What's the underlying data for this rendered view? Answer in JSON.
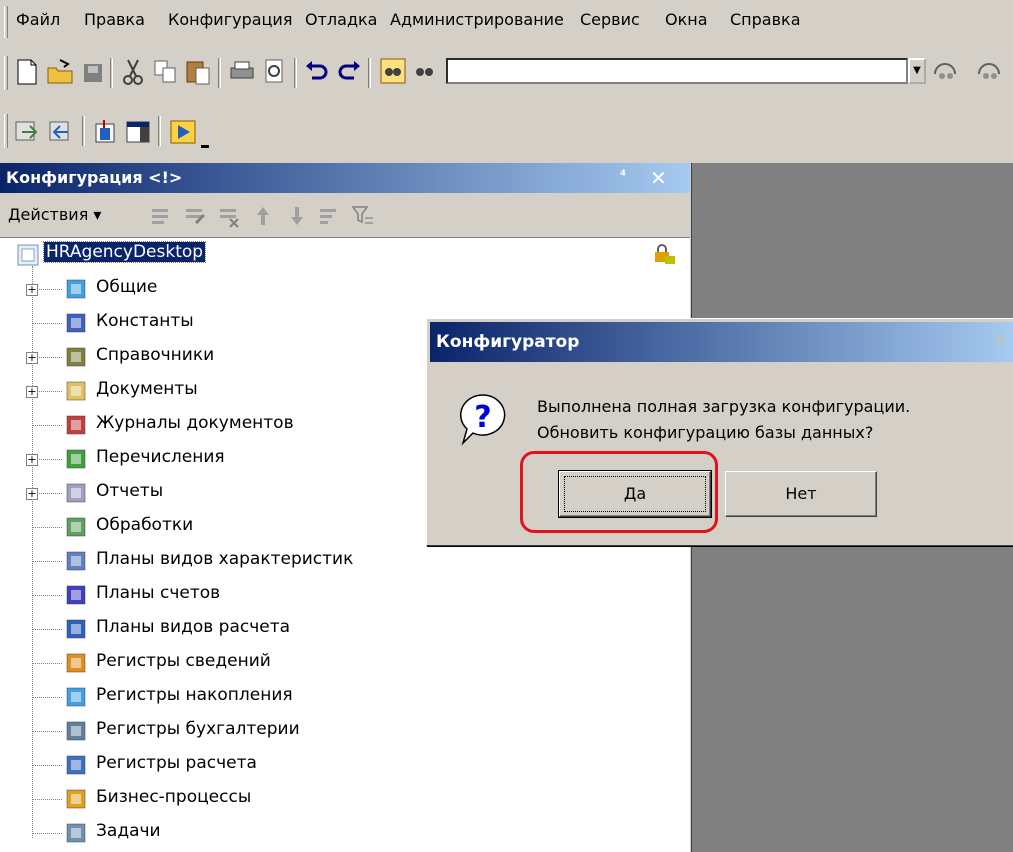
{
  "menu": {
    "items": [
      {
        "label": "Файл"
      },
      {
        "label": "Правка"
      },
      {
        "label": "Конфигурация"
      },
      {
        "label": "Отладка"
      },
      {
        "label": "Администрирование"
      },
      {
        "label": "Сервис"
      },
      {
        "label": "Окна"
      },
      {
        "label": "Справка"
      }
    ]
  },
  "toolbar": {
    "search_value": ""
  },
  "panel": {
    "title": "Конфигурация <!>",
    "pin": "⁴",
    "close": "✕",
    "actions_label": "Действия ▾"
  },
  "tree": {
    "root": "HRAgencyDesktop",
    "items": [
      {
        "label": "Общие",
        "expandable": true,
        "icon": "general-icon"
      },
      {
        "label": "Константы",
        "expandable": false,
        "icon": "constants-icon"
      },
      {
        "label": "Справочники",
        "expandable": true,
        "icon": "catalogs-icon"
      },
      {
        "label": "Документы",
        "expandable": true,
        "icon": "documents-icon"
      },
      {
        "label": "Журналы документов",
        "expandable": false,
        "icon": "journals-icon"
      },
      {
        "label": "Перечисления",
        "expandable": true,
        "icon": "enums-icon"
      },
      {
        "label": "Отчеты",
        "expandable": true,
        "icon": "reports-icon"
      },
      {
        "label": "Обработки",
        "expandable": false,
        "icon": "processing-icon"
      },
      {
        "label": "Планы видов характеристик",
        "expandable": false,
        "icon": "char-plans-icon"
      },
      {
        "label": "Планы счетов",
        "expandable": false,
        "icon": "accounts-plans-icon"
      },
      {
        "label": "Планы видов расчета",
        "expandable": false,
        "icon": "calc-plans-icon"
      },
      {
        "label": "Регистры сведений",
        "expandable": false,
        "icon": "info-registers-icon"
      },
      {
        "label": "Регистры накопления",
        "expandable": false,
        "icon": "accum-registers-icon"
      },
      {
        "label": "Регистры бухгалтерии",
        "expandable": false,
        "icon": "accounting-registers-icon"
      },
      {
        "label": "Регистры расчета",
        "expandable": false,
        "icon": "calc-registers-icon"
      },
      {
        "label": "Бизнес-процессы",
        "expandable": false,
        "icon": "business-processes-icon"
      },
      {
        "label": "Задачи",
        "expandable": false,
        "icon": "tasks-icon"
      }
    ]
  },
  "dialog": {
    "title": "Конфигуратор",
    "close": "✕",
    "message_line1": "Выполнена полная загрузка конфигурации.",
    "message_line2": "Обновить конфигурацию базы данных?",
    "yes_label": "Да",
    "no_label": "Нет"
  }
}
